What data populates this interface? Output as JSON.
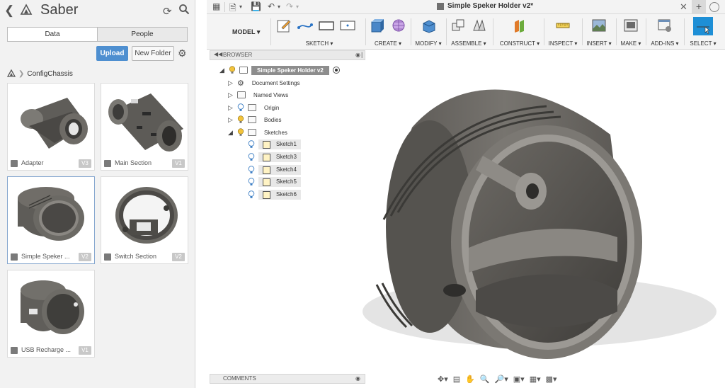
{
  "data_panel": {
    "title": "Saber",
    "tabs": [
      "Data",
      "People"
    ],
    "upload_label": "Upload",
    "new_folder_label": "New Folder",
    "breadcrumb": "ConfigChassis",
    "files": [
      {
        "name": "Adapter",
        "version": "V3"
      },
      {
        "name": "Main Section",
        "version": "V1"
      },
      {
        "name": "Simple Speker ...",
        "version": "V2"
      },
      {
        "name": "Switch Section",
        "version": "V2"
      },
      {
        "name": "USB Recharge ...",
        "version": "V1"
      }
    ]
  },
  "document": {
    "title": "Simple Speker Holder v2*"
  },
  "toolbar": {
    "workspace": "MODEL",
    "groups": [
      "SKETCH",
      "CREATE",
      "MODIFY",
      "ASSEMBLE",
      "CONSTRUCT",
      "INSPECT",
      "INSERT",
      "MAKE",
      "ADD-INS",
      "SELECT"
    ]
  },
  "browser": {
    "header": "BROWSER",
    "root": "Simple Speker Holder v2",
    "items": [
      "Document Settings",
      "Named Views",
      "Origin",
      "Bodies",
      "Sketches"
    ],
    "sketches": [
      "Sketch1",
      "Sketch3",
      "Sketch4",
      "Sketch5",
      "Sketch6"
    ]
  },
  "comments_label": "COMMENTS",
  "colors": {
    "upload_blue": "#4e8fd0",
    "select_blue": "#1e8fd6",
    "model_gray": "#6e6b66"
  }
}
